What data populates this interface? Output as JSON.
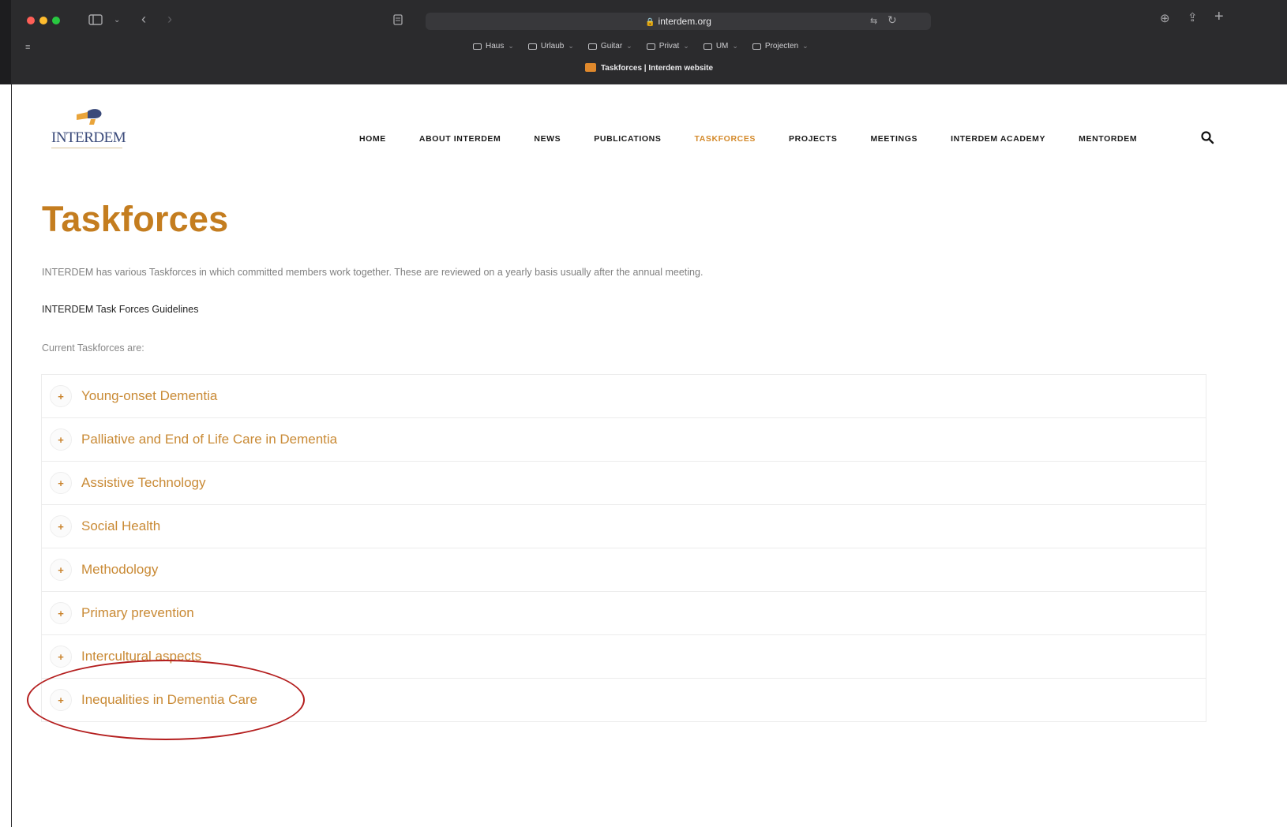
{
  "browser": {
    "url": "interdem.org",
    "tab_title": "Taskforces | Interdem website",
    "bookmarks": [
      {
        "label": "Haus"
      },
      {
        "label": "Urlaub"
      },
      {
        "label": "Guitar"
      },
      {
        "label": "Privat"
      },
      {
        "label": "UM"
      },
      {
        "label": "Projecten"
      }
    ],
    "traffic_colors": [
      "#ff5f57",
      "#febc2e",
      "#28c840"
    ]
  },
  "site": {
    "logo_text": "INTERDEM",
    "nav": [
      {
        "label": "HOME"
      },
      {
        "label": "ABOUT INTERDEM"
      },
      {
        "label": "NEWS"
      },
      {
        "label": "PUBLICATIONS"
      },
      {
        "label": "TASKFORCES",
        "active": true
      },
      {
        "label": "PROJECTS"
      },
      {
        "label": "MEETINGS"
      },
      {
        "label": "INTERDEM ACADEMY"
      },
      {
        "label": "MENTORDEM"
      }
    ],
    "accent_color": "#c47d1f"
  },
  "content": {
    "title": "Taskforces",
    "intro": "INTERDEM has various Taskforces in which committed members work together. These are reviewed on a yearly basis usually after the annual meeting.",
    "guidelines_link": "INTERDEM Task Forces Guidelines",
    "current_label": "Current Taskforces are:",
    "taskforces": [
      {
        "label": "Young-onset Dementia"
      },
      {
        "label": "Palliative and End of Life Care in Dementia"
      },
      {
        "label": "Assistive Technology"
      },
      {
        "label": "Social Health"
      },
      {
        "label": "Methodology"
      },
      {
        "label": "Primary prevention",
        "highlighted": true
      },
      {
        "label": "Intercultural aspects"
      },
      {
        "label": "Inequalities in Dementia Care"
      }
    ],
    "plus_glyph": "+"
  }
}
